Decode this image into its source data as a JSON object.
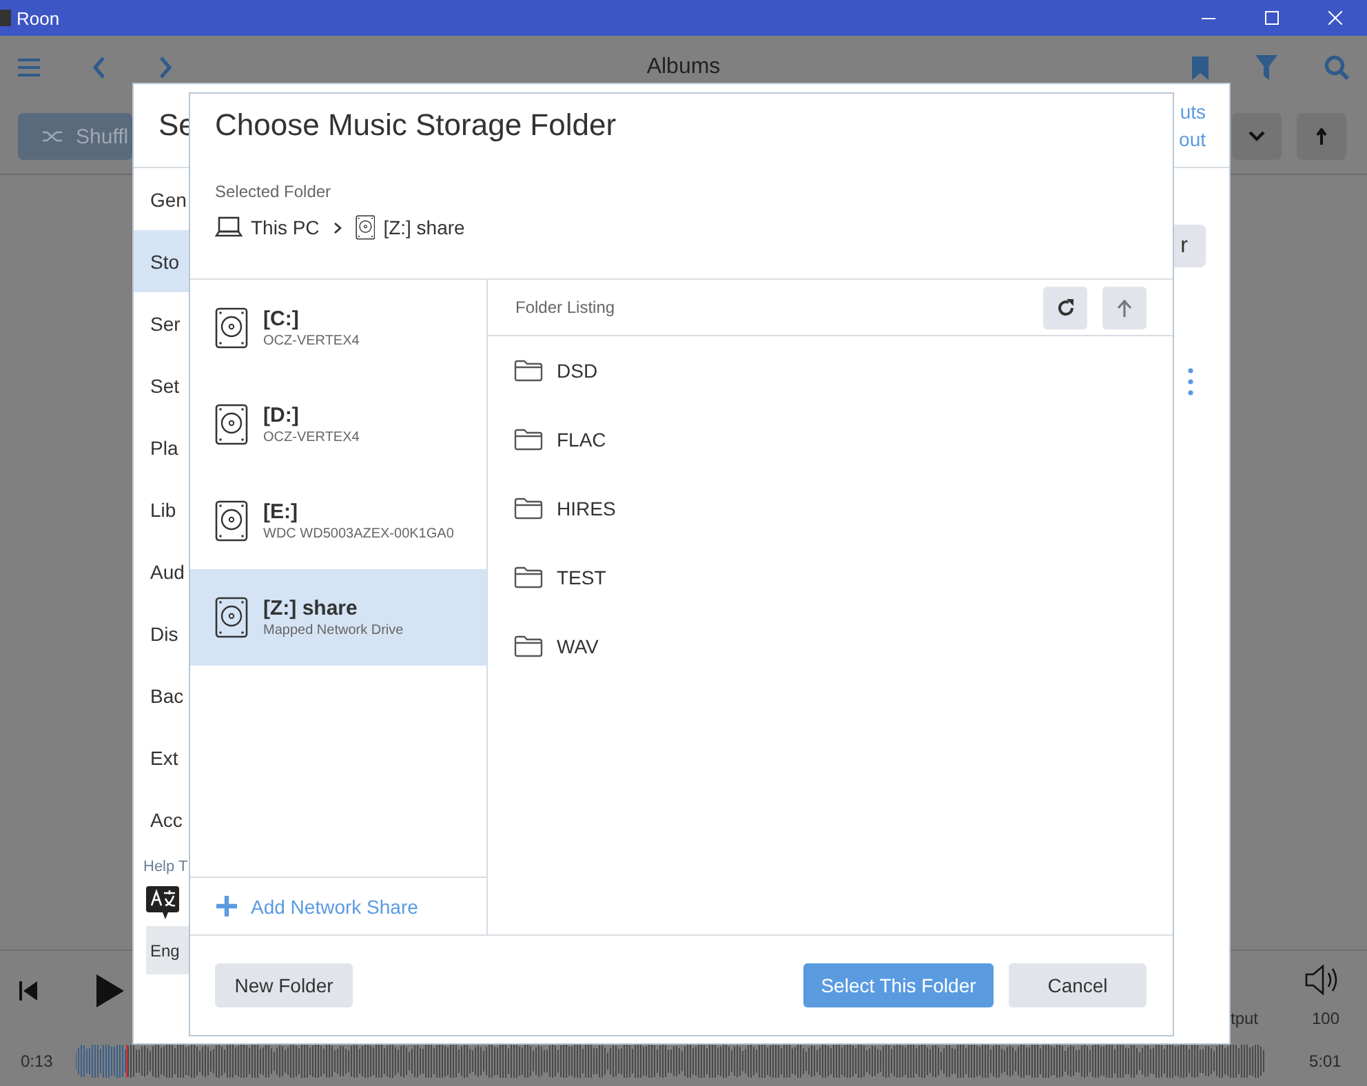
{
  "window": {
    "title": "Roon"
  },
  "toolbar": {
    "title": "Albums"
  },
  "shuffle_button": {
    "label": "Shuffl"
  },
  "player": {
    "elapsed": "0:13",
    "duration": "5:01",
    "volume": "100",
    "output_label": "tput"
  },
  "settings_dialog": {
    "title": "Se",
    "links": [
      "uts",
      "out"
    ],
    "nav": [
      {
        "label": "Gen",
        "selected": false
      },
      {
        "label": "Sto",
        "selected": true
      },
      {
        "label": "Ser",
        "selected": false
      },
      {
        "label": "Set",
        "selected": false
      },
      {
        "label": "Pla",
        "selected": false
      },
      {
        "label": "Lib",
        "selected": false
      },
      {
        "label": "Aud",
        "selected": false
      },
      {
        "label": "Dis",
        "selected": false
      },
      {
        "label": "Bac",
        "selected": false
      },
      {
        "label": "Ext",
        "selected": false
      },
      {
        "label": "Acc",
        "selected": false
      }
    ],
    "help_label": "Help T",
    "language_button": "Eng",
    "action_button": "r"
  },
  "folder_dialog": {
    "title": "Choose Music Storage Folder",
    "selected_folder_label": "Selected Folder",
    "breadcrumb": [
      {
        "kind": "computer",
        "label": "This PC"
      },
      {
        "kind": "drive",
        "label": "[Z:] share"
      }
    ],
    "drives": [
      {
        "name": "[C:]",
        "detail": "OCZ-VERTEX4",
        "selected": false
      },
      {
        "name": "[D:]",
        "detail": "OCZ-VERTEX4",
        "selected": false
      },
      {
        "name": "[E:]",
        "detail": "WDC WD5003AZEX-00K1GA0",
        "selected": false
      },
      {
        "name": "[Z:] share",
        "detail": "Mapped Network Drive",
        "selected": true
      }
    ],
    "add_share": "Add Network Share",
    "listing_label": "Folder Listing",
    "folders": [
      "DSD",
      "FLAC",
      "HIRES",
      "TEST",
      "WAV"
    ],
    "buttons": [
      {
        "kind": "secondary",
        "label": "New Folder"
      },
      {
        "kind": "primary",
        "label": "Select This Folder"
      },
      {
        "kind": "secondary",
        "label": "Cancel"
      }
    ]
  }
}
